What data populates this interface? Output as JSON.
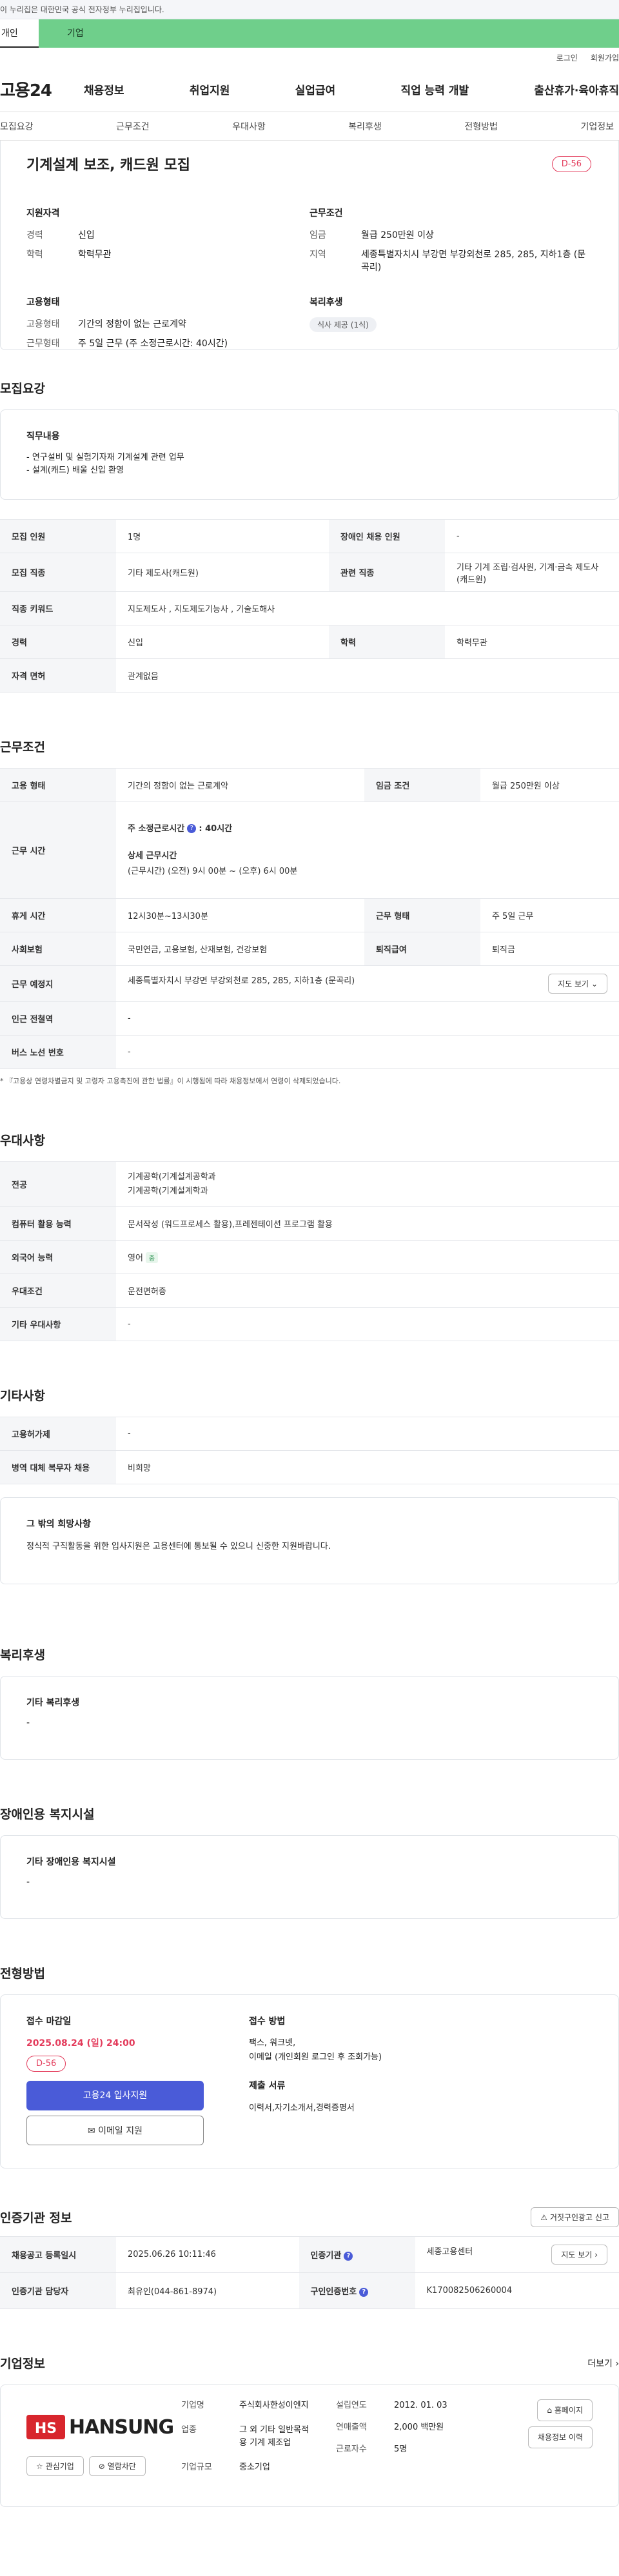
{
  "gov_banner": "이 누리집은 대한민국 공식 전자정부 누리집입니다.",
  "site_tabs": [
    "개인",
    "기업"
  ],
  "util": [
    "로그인",
    "회원가입"
  ],
  "logo": "고용24",
  "gnb": [
    "채용정보",
    "취업지원",
    "실업급여",
    "직업 능력 개발",
    "출산휴가·육아휴직"
  ],
  "tabs": [
    "모집요강",
    "근무조건",
    "우대사항",
    "복리후생",
    "전형방법",
    "기업정보"
  ],
  "summary": {
    "title": "기계설계 보조, 캐드원 모집",
    "dday": "D-56",
    "qual_title": "지원자격",
    "career_label": "경력",
    "career": "신입",
    "edu_label": "학력",
    "edu": "학력무관",
    "cond_title": "근무조건",
    "wage_label": "임금",
    "wage": "월급 250만원 이상",
    "region_label": "지역",
    "region": "세종특별자치시 부강면 부강외천로 285, 285, 지하1층 (문곡리)",
    "emp_title": "고용형태",
    "emp_label": "고용형태",
    "emp": "기간의 정함이 없는 근로계약",
    "hours_label": "근무형태",
    "hours": "주 5일 근무 (주 소정근로시간: 40시간)",
    "welfare_title": "복리후생",
    "welfare_chip": "식사 제공 (1식)"
  },
  "recruit": {
    "title": "모집요강",
    "duty_title": "직무내용",
    "duty": [
      "- 연구설비 및 실험기자재 기계설계 관련 업무",
      "- 설계(캐드) 배울 신입 환영"
    ],
    "rows": [
      {
        "k1": "모집 인원",
        "v1": "1명",
        "k2": "장애인 채용 인원",
        "v2": "-"
      },
      {
        "k1": "모집 직종",
        "v1": "기타 제도사(캐드원)",
        "k2": "관련 직종",
        "v2": "기타 기계 조립·검사원, 기계·금속 제도사(캐드원)"
      },
      {
        "k1": "직종 키워드",
        "v1": "지도제도사 , 지도제도기능사 , 기술도해사"
      },
      {
        "k1": "경력",
        "v1": "신입",
        "k2": "학력",
        "v2": "학력무관"
      },
      {
        "k1": "자격 면허",
        "v1": "관계없음"
      }
    ]
  },
  "work": {
    "title": "근무조건",
    "emp_k": "고용 형태",
    "emp_v": "기간의 정함이 없는 근로계약",
    "wage_k": "임금 조건",
    "wage_v": "월급 250만원 이상",
    "time_k": "근무 시간",
    "time_v1": "주 소정근로시간",
    "time_v1b": ": 40시간",
    "time_v2": "상세 근무시간",
    "time_v3": "(근무시간) (오전) 9시 00분 ~ (오후) 6시 00분",
    "rest_k": "휴게 시간",
    "rest_v": "12시30분~13시30분",
    "form_k": "근무 형태",
    "form_v": "주 5일 근무",
    "ins_k": "사회보험",
    "ins_v": "국민연금, 고용보험, 산재보험, 건강보험",
    "ret_k": "퇴직급여",
    "ret_v": "퇴직금",
    "place_k": "근무 예정지",
    "place_v": "세종특별자치시 부강면 부강외천로 285, 285, 지하1층 (문곡리)",
    "map_btn": "지도 보기",
    "sub_k": "인근 전철역",
    "sub_v": "-",
    "bus_k": "버스 노선 번호",
    "bus_v": "-",
    "note": "* 『고용상 연령차별금지 및 고령자 고용촉진에 관한 법률』이 시행됨에 따라 채용정보에서 연령이 삭제되었습니다."
  },
  "pref": {
    "title": "우대사항",
    "major_k": "전공",
    "major_v1": "기계공학(기계설계공학과",
    "major_v2": "기계공학(기계설계학과",
    "pc_k": "컴퓨터 활용 능력",
    "pc_v": "문서작성 (워드프로세스 활용),프레젠테이션 프로그램 활용",
    "lang_k": "외국어 능력",
    "lang_v": "영어",
    "lang_tag": "중",
    "cond_k": "우대조건",
    "cond_v": "운전면허증",
    "etc_k": "기타 우대사항",
    "etc_v": "-"
  },
  "other": {
    "title": "기타사항",
    "care_k": "고용허가제",
    "care_v": "-",
    "mil_k": "병역 대체 복무자 채용",
    "mil_v": "비희망",
    "extra_title": "그 밖의 희망사항",
    "extra": "정식적 구직활동을 위한 입사지원은 고용센터에 통보될 수 있으니 신중한 지원바랍니다."
  },
  "welfare": {
    "title": "복리후생",
    "sub": "기타 복리후생",
    "val": "-"
  },
  "disab": {
    "title": "장애인용 복지시설",
    "sub": "기타 장애인용 복지시설",
    "val": "-"
  },
  "apply": {
    "title": "전형방법",
    "deadline_k": "접수 마감일",
    "deadline": "2025.08.24 (일) 24:00",
    "dday": "D-56",
    "apply_btn": "고용24 입사지원",
    "mail_btn": "이메일 지원",
    "method_k": "접수 방법",
    "method_v1": "팩스, 워크넷,",
    "method_v2": "이메일 (개인회원 로그인 후 조회가능)",
    "doc_k": "제출 서류",
    "doc_v": "이력서,자기소개서,경력증명서"
  },
  "agency": {
    "title": "인증기관 정보",
    "report_btn": "거짓구인광고 신고",
    "reg_k": "채용공고 등록일시",
    "reg_v": "2025.06.26 10:11:46",
    "org_k": "인증기관",
    "org_v": "세종고용센터",
    "map_btn": "지도 보기",
    "mgr_k": "인증기관 담당자",
    "mgr_v": "최유인(044-861-8974)",
    "no_k": "구인인증번호",
    "no_v": "K170082506260004"
  },
  "company": {
    "title": "기업정보",
    "more": "더보기",
    "logo_text": "HANSUNG",
    "fav_btn": "관심기업",
    "ban_btn": "열람차단",
    "name_k": "기업명",
    "name_v": "주식회사한성이엔지",
    "ind_k": "업종",
    "ind_v": "그 외 기타 일반목적용 기계 제조업",
    "size_k": "기업규모",
    "size_v": "중소기업",
    "est_k": "설립연도",
    "est_v": "2012. 01. 03",
    "sales_k": "연매출액",
    "sales_v": "2,000 백만원",
    "emp_k": "근로자수",
    "emp_v": "5명",
    "home_btn": "홈페이지",
    "list_btn": "채용정보 이력"
  }
}
